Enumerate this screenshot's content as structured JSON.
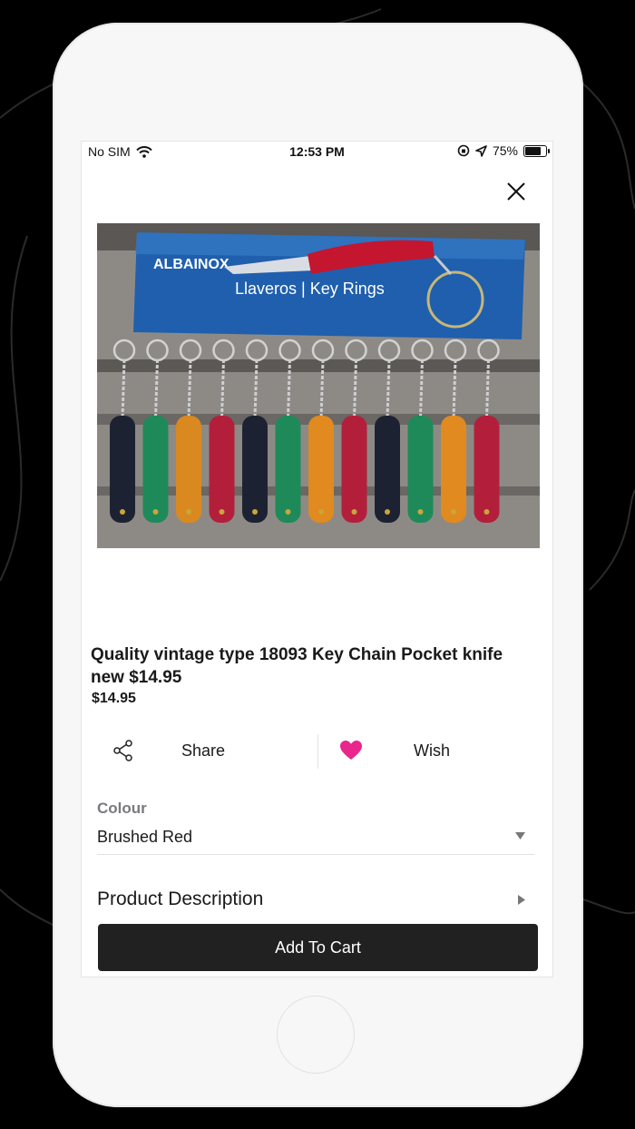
{
  "status_bar": {
    "carrier": "No SIM",
    "time": "12:53 PM",
    "battery": "75%",
    "battery_level": 0.75
  },
  "product": {
    "title": "Quality vintage type 18093 Key Chain Pocket knife new $14.95",
    "price": "$14.95",
    "image_alt": "Key chain pocket knives on display card",
    "image_card_brand": "ALBAINOX",
    "image_card_text": "Llaveros | Key Rings",
    "knife_colors": [
      "#1d2233",
      "#1e8a5a",
      "#d9891f",
      "#b31f3b",
      "#1d2233",
      "#1e8a5a",
      "#e08a1f",
      "#b31f3b",
      "#1d2233",
      "#1e8a5a",
      "#e08a1f",
      "#b31f3b"
    ]
  },
  "actions": {
    "share_label": "Share",
    "share_icon": "share-icon",
    "wish_label": "Wish",
    "wish_icon": "heart-icon",
    "wish_color": "#e8268c"
  },
  "colour": {
    "label": "Colour",
    "selected": "Brushed Red"
  },
  "description": {
    "label": "Product Description"
  },
  "cart": {
    "button_label": "Add To Cart"
  }
}
